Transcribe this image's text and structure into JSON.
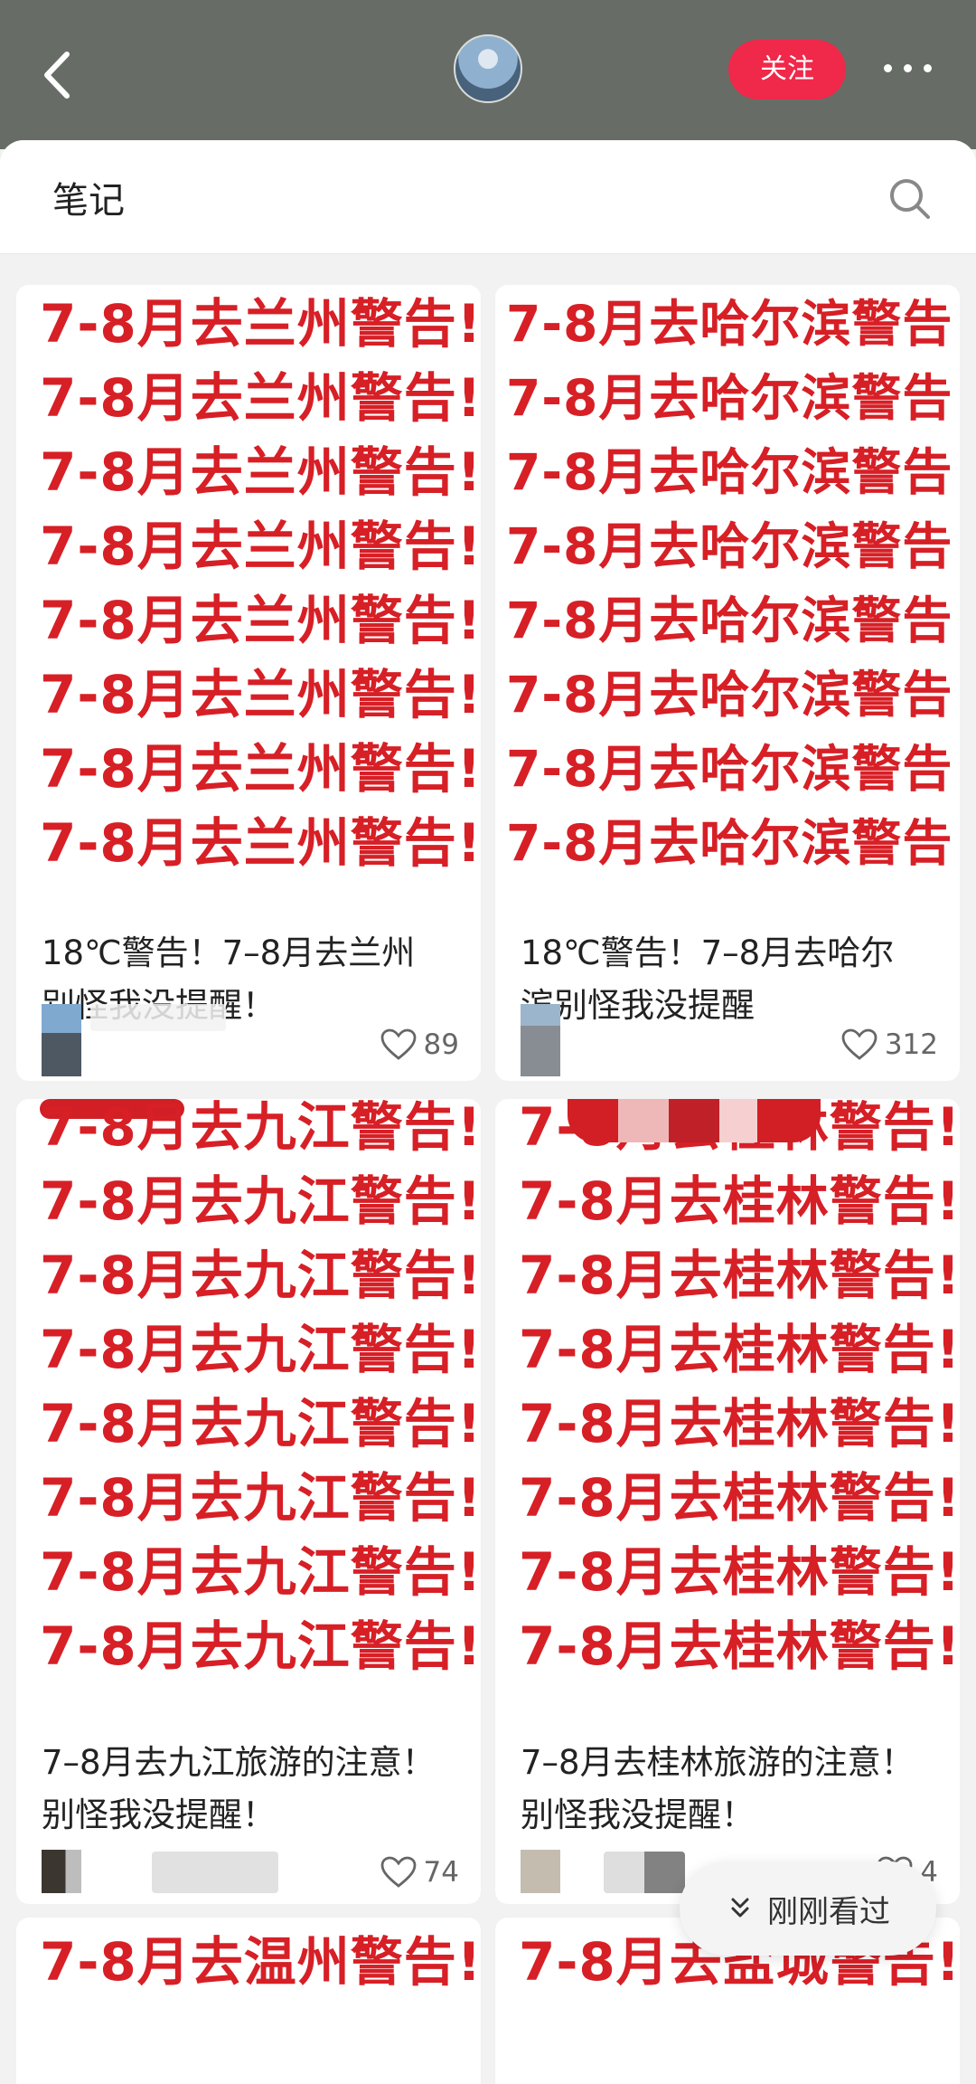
{
  "header": {
    "follow_label": "关注"
  },
  "sheet": {
    "title": "笔记"
  },
  "notes": [
    {
      "cover_text": "7-8月去兰州警告!",
      "title": "18℃警告！7–8月去兰州别怪我没提醒！",
      "likes": "89"
    },
    {
      "cover_text": "7-8月去哈尔滨警告!",
      "title": "18℃警告！7–8月去哈尔滨别怪我没提醒",
      "likes": "312"
    },
    {
      "cover_text": "7-8月去九江警告!",
      "title": "7–8月去九江旅游的注意！别怪我没提醒！",
      "likes": "74"
    },
    {
      "cover_text": "7-8月去桂林警告!",
      "title": "7–8月去桂林旅游的注意！别怪我没提醒！",
      "likes": "4"
    },
    {
      "cover_text": "7-8月去温州警告!"
    },
    {
      "cover_text": "7-8月去盐城警告!"
    }
  ],
  "floating": {
    "label": "刚刚看过"
  },
  "colors": {
    "accent": "#f0284a",
    "cover_red": "#d71f26",
    "topbar": "#676d66"
  }
}
